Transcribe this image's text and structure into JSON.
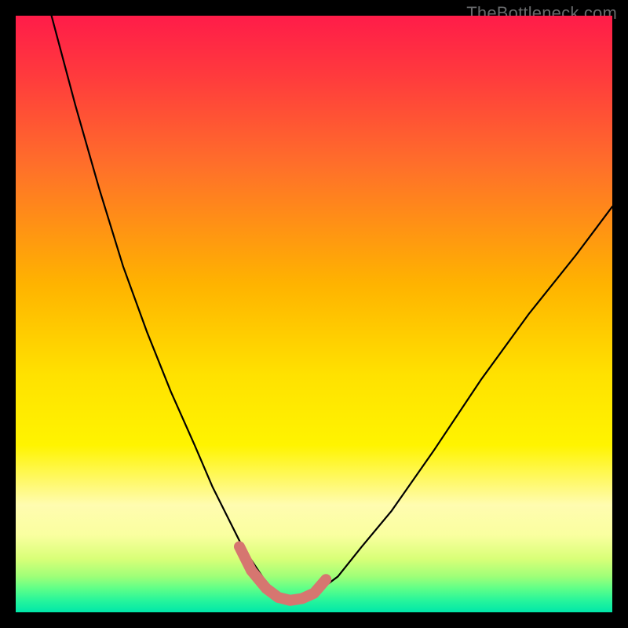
{
  "watermark": {
    "text": "TheBottleneck.com"
  },
  "colors": {
    "background": "#000000",
    "curve_stroke": "#000000",
    "highlight_stroke": "#d67670",
    "gradient_top": "#ff1c49",
    "gradient_bottom": "#00e7a9"
  },
  "chart_data": {
    "type": "line",
    "title": "",
    "xlabel": "",
    "ylabel": "",
    "xlim": [
      0,
      100
    ],
    "ylim": [
      0,
      100
    ],
    "series": [
      {
        "name": "bottleneck-curve",
        "x": [
          6,
          10,
          14,
          18,
          22,
          26,
          30,
          33,
          36,
          38,
          40,
          42,
          44,
          46,
          48,
          50,
          54,
          58,
          63,
          70,
          78,
          86,
          94,
          100
        ],
        "y": [
          100,
          85,
          71,
          58,
          47,
          37,
          28,
          21,
          15,
          11,
          8,
          5,
          3,
          2,
          2,
          3,
          6,
          11,
          17,
          27,
          39,
          50,
          60,
          68
        ]
      },
      {
        "name": "optimal-highlight",
        "x": [
          37.5,
          39.5,
          42,
          44,
          46,
          48,
          50,
          52
        ],
        "y": [
          11,
          7,
          4,
          2.5,
          2,
          2.3,
          3.2,
          5.5
        ]
      }
    ]
  }
}
